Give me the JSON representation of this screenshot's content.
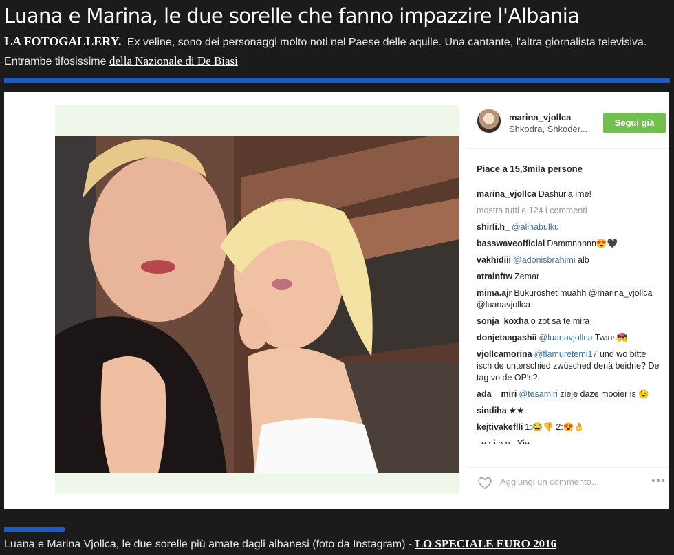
{
  "article": {
    "headline": "Luana e Marina, le due sorelle che fanno impazzire l'Albania",
    "kicker": "LA FOTOGALLERY.",
    "lede_text": "Ex veline, sono dei personaggi molto noti nel Paese delle aquile. Una cantante, l'altra giornalista televisiva. Entrambe tifosissime",
    "lede_link": "della Nazionale di De Biasi",
    "caption_text": "Luana e Marina Vjollca, le due sorelle più amate dagli albanesi (foto da Instagram) -",
    "caption_link": "LO SPECIALE EURO 2016",
    "accent_color": "#1c59c8"
  },
  "instagram": {
    "username": "marina_vjollca",
    "location": "Shkodra, Shkodër...",
    "follow_label": "Segui già",
    "follow_color": "#70c050",
    "likes": "Piace a 15,3mila persone",
    "caption_user": "marina_vjollca",
    "caption_text": "Dashuria ime!",
    "more_comments": "mostra tutti e 124 i commenti",
    "comments": [
      {
        "user": "shirli.h_",
        "mention": "@alinabulku",
        "text": ""
      },
      {
        "user": "basswaveofficial",
        "mention": "",
        "text": "Dammnnnnn😍🖤"
      },
      {
        "user": "vakhidiii",
        "mention": "@adonisbrahimi",
        "text": "alb"
      },
      {
        "user": "atrainftw",
        "mention": "",
        "text": "Zemar"
      },
      {
        "user": "mima.ajr",
        "mention": "",
        "text": "Bukuroshet muahh @marina_vjollca @luanavjollca"
      },
      {
        "user": "sonja_koxha",
        "mention": "",
        "text": "o zot sa te mira"
      },
      {
        "user": "donjetaagashii",
        "mention": "@luanavjollca",
        "text": "Twins💏"
      },
      {
        "user": "vjollcamorina",
        "mention": "@flamuretemi17",
        "text": "und wo bitte isch de unterschied zwüsched denä beidne? De tag vo de OP's?"
      },
      {
        "user": "ada__miri",
        "mention": "@tesamiri",
        "text": "zieje daze mooier is 😉"
      },
      {
        "user": "sindiha",
        "mention": "",
        "text": "★★"
      },
      {
        "user": "kejtivakeflli",
        "mention": "",
        "text": "1:😂👎 2:😍👌"
      }
    ],
    "cut_row": "_e r i o n_ Yje",
    "add_comment": "Aggiungi un commento...",
    "more_icon": "•••"
  }
}
